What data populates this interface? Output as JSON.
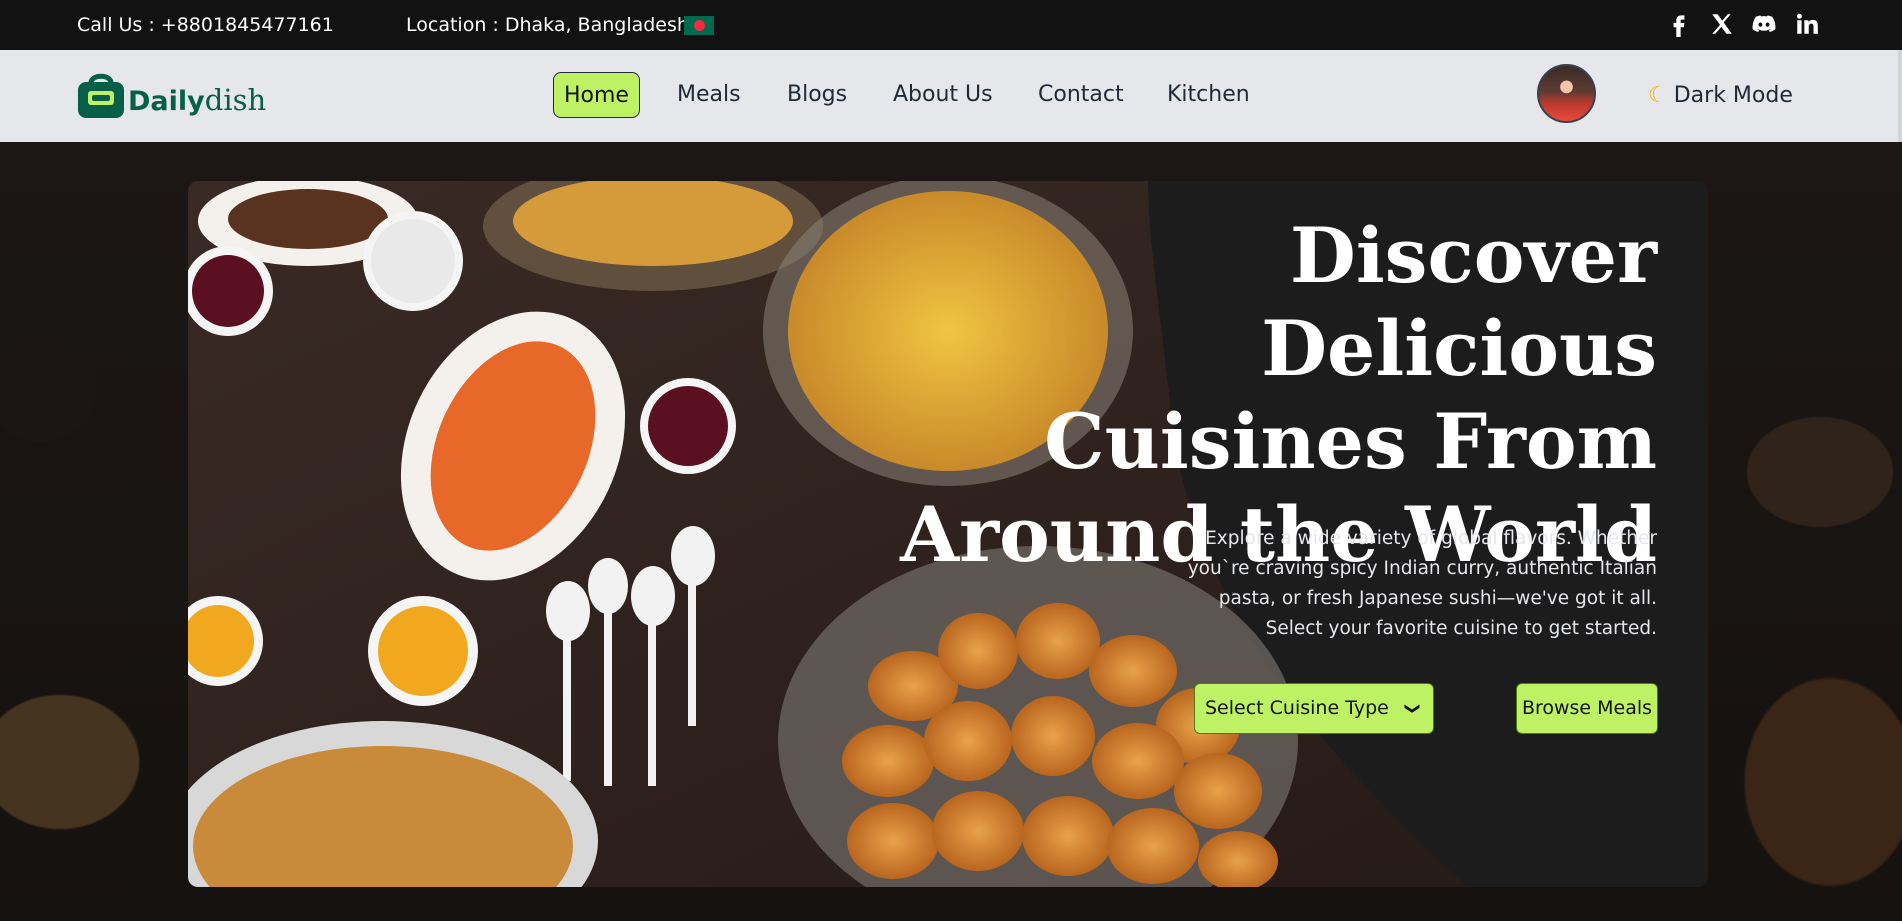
{
  "topbar": {
    "call": "Call Us : +8801845477161",
    "location": "Location : Dhaka, Bangladesh",
    "flag_icon": "bangladesh-flag-icon",
    "social": [
      "facebook-icon",
      "x-icon",
      "discord-icon",
      "linkedin-icon"
    ]
  },
  "brand": {
    "name_bold": "Daily",
    "name_rest": "dish",
    "color": "#065f46"
  },
  "nav": {
    "items": [
      "Home",
      "Meals",
      "Blogs",
      "About Us",
      "Contact",
      "Kitchen"
    ],
    "active": "Home",
    "active_color": "#bef264"
  },
  "user": {
    "avatar_icon": "user-avatar"
  },
  "theme_toggle": {
    "label": "Dark Mode",
    "icon": "moon-icon"
  },
  "hero": {
    "title": "Discover Delicious Cuisines From Around the World",
    "description": "Explore a wide variety of global flavors. Whether you`re craving spicy Indian curry, authentic Italian pasta, or fresh Japanese sushi—we've got it all. Select your favorite cuisine to get started.",
    "select_label": "Select Cuisine Type",
    "browse_label": "Browse Meals",
    "button_color": "#bef264"
  }
}
